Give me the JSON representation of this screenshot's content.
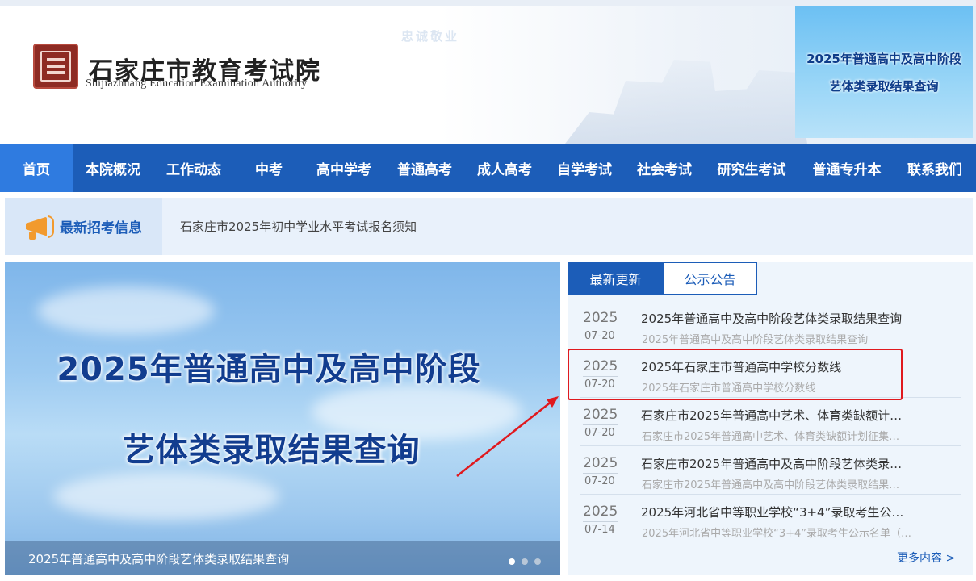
{
  "header": {
    "logo_cn": "石家庄市教育考试院",
    "logo_en": "Shijiazhuang Education Examination Authority",
    "motto": "忠诚敬业",
    "promo": {
      "line1": "2025年普通高中及高中阶段",
      "line2": "艺体类录取结果查询"
    }
  },
  "nav": {
    "items": [
      {
        "label": "首页"
      },
      {
        "label": "本院概况"
      },
      {
        "label": "工作动态"
      },
      {
        "label": "中考"
      },
      {
        "label": "高中学考"
      },
      {
        "label": "普通高考"
      },
      {
        "label": "成人高考"
      },
      {
        "label": "自学考试"
      },
      {
        "label": "社会考试"
      },
      {
        "label": "研究生考试"
      },
      {
        "label": "普通专升本"
      },
      {
        "label": "联系我们"
      }
    ]
  },
  "notice": {
    "label": "最新招考信息",
    "text": "石家庄市2025年初中学业水平考试报名须知"
  },
  "banner": {
    "line1": "2025年普通高中及高中阶段",
    "line2": "艺体类录取结果查询",
    "caption": "2025年普通高中及高中阶段艺体类录取结果查询"
  },
  "news": {
    "tabs": [
      {
        "label": "最新更新"
      },
      {
        "label": "公示公告"
      }
    ],
    "items": [
      {
        "year": "2025",
        "date": "07-20",
        "title": "2025年普通高中及高中阶段艺体类录取结果查询",
        "sub": "2025年普通高中及高中阶段艺体类录取结果查询"
      },
      {
        "year": "2025",
        "date": "07-20",
        "title": "2025年石家庄市普通高中学校分数线",
        "sub": "2025年石家庄市普通高中学校分数线"
      },
      {
        "year": "2025",
        "date": "07-20",
        "title": "石家庄市2025年普通高中艺术、体育类缺额计…",
        "sub": "石家庄市2025年普通高中艺术、体育类缺额计划征集…"
      },
      {
        "year": "2025",
        "date": "07-20",
        "title": "石家庄市2025年普通高中及高中阶段艺体类录…",
        "sub": "石家庄市2025年普通高中及高中阶段艺体类录取结果…"
      },
      {
        "year": "2025",
        "date": "07-14",
        "title": "2025年河北省中等职业学校“3+4”录取考生公…",
        "sub": "2025年河北省中等职业学校“3+4”录取考生公示名单（…"
      }
    ],
    "more": "更多内容 >"
  },
  "colors": {
    "nav_bg": "#1c5db8",
    "nav_active": "#2f7be0",
    "highlight": "#e0191e",
    "seal": "#8e2b23"
  }
}
